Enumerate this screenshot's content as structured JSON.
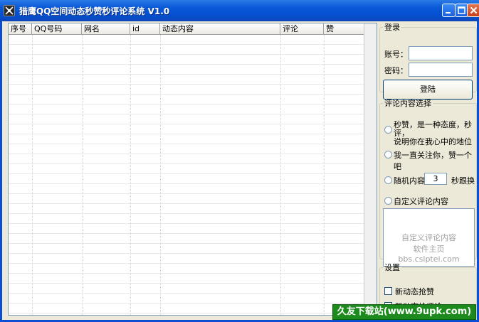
{
  "window": {
    "title": "猎鹰QQ空间动态秒赞秒评论系统 V1.0"
  },
  "grid": {
    "columns": [
      "序号",
      "QQ号码",
      "网名",
      "id",
      "动态内容",
      "评论",
      "赞"
    ]
  },
  "login": {
    "legend": "登录",
    "account_label": "账号：",
    "password_label": "密码：",
    "account_value": "",
    "password_value": "",
    "login_button": "登陆"
  },
  "comment_choice": {
    "legend": "评论内容选择",
    "option1_line1": "秒赞，是一种态度，秒评，",
    "option1_line2": "说明你在我心中的地位",
    "option2": "我一直关注你，赞一个吧",
    "option3_prefix": "随机内容",
    "random_seconds": "3",
    "option3_suffix": "秒跟换",
    "option4": "自定义评论内容",
    "custom_placeholder_line1": "自定义评论内容",
    "custom_placeholder_line2": "软件主页 bbs.cslptei.com"
  },
  "settings": {
    "legend": "设置",
    "check1": "新动态抢赞",
    "check2": "新动态抢评论"
  },
  "watermark": "久友下载站(www.9upk.com)"
}
